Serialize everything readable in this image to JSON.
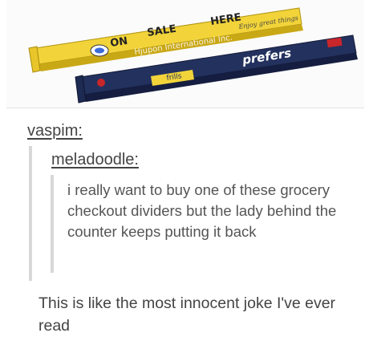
{
  "photo": {
    "yellow_bar": {
      "words": [
        "ON",
        "SALE",
        "HERE"
      ],
      "tagline": "Enjoy great things",
      "watermark": "Hjupon International Inc."
    },
    "blue_bar": {
      "brand": "prefers",
      "sticker": "frills"
    },
    "colors": {
      "yellow": "#f2d43a",
      "navy": "#23315e",
      "shadow": "#cfcfcf"
    }
  },
  "chain": {
    "poster": "vaspim:",
    "quoted_user": "meladoodle:",
    "quoted_text": "i really want to buy one of these grocery checkout dividers but the lady behind the counter keeps putting it back",
    "reply_text": "This is like the most innocent joke I've ever read"
  }
}
